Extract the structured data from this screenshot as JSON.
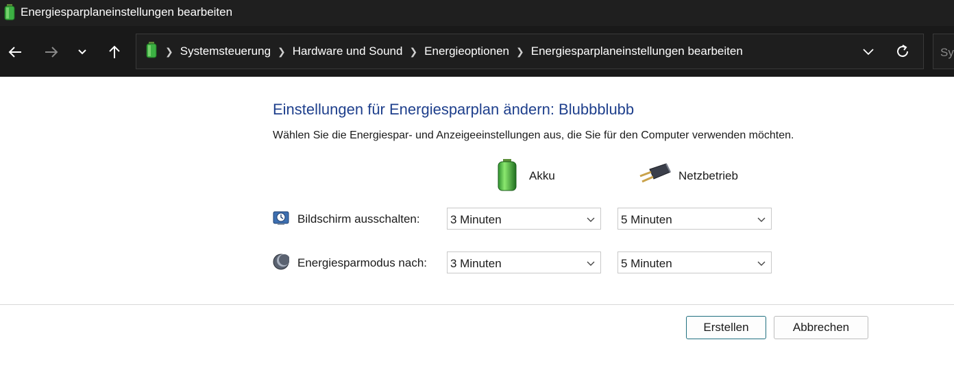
{
  "window": {
    "title": "Energiesparplaneinstellungen bearbeiten"
  },
  "nav": {
    "back_icon": "arrow-left-icon",
    "forward_icon": "arrow-right-icon",
    "history_icon": "chevron-down-icon",
    "up_icon": "arrow-up-icon"
  },
  "breadcrumb": {
    "items": [
      "Systemsteuerung",
      "Hardware und Sound",
      "Energieoptionen",
      "Energiesparplaneinstellungen bearbeiten"
    ]
  },
  "search": {
    "placeholder": "Sys"
  },
  "main": {
    "heading": "Einstellungen für Energiesparplan ändern: Blubbblubb",
    "subtitle": "Wählen Sie die Energiespar- und Anzeigeeinstellungen aus, die Sie für den Computer verwenden möchten.",
    "columns": {
      "battery": "Akku",
      "plugged": "Netzbetrieb"
    },
    "rows": [
      {
        "label": "Bildschirm ausschalten:",
        "battery_value": "3 Minuten",
        "plugged_value": "5 Minuten"
      },
      {
        "label": "Energiesparmodus nach:",
        "battery_value": "3 Minuten",
        "plugged_value": "5 Minuten"
      }
    ]
  },
  "buttons": {
    "create": "Erstellen",
    "cancel": "Abbrechen"
  },
  "colors": {
    "heading": "#1e3f8c",
    "titlebar": "#1f1f1f",
    "navbar": "#191919",
    "battery_green": "#3cb043"
  }
}
